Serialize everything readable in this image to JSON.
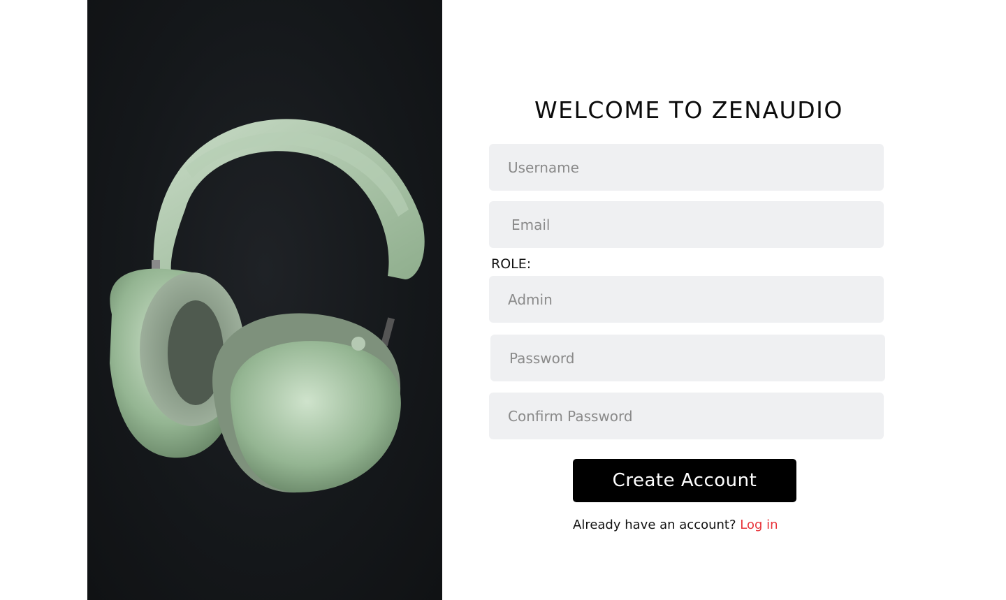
{
  "brand": {
    "welcome_title": "WELCOME TO ZENAUDIO"
  },
  "hero": {
    "image_subject": "headphones-image"
  },
  "form": {
    "username": {
      "placeholder": "Username",
      "value": ""
    },
    "email": {
      "placeholder": "Email",
      "value": ""
    },
    "role_label": "ROLE:",
    "role": {
      "placeholder": "Admin",
      "value": ""
    },
    "password": {
      "placeholder": "Password",
      "value": ""
    },
    "confirm_password": {
      "placeholder": "Confirm Password",
      "value": ""
    },
    "submit_label": "Create Account",
    "login_prompt": "Already have an account?",
    "login_link": "Log in"
  },
  "colors": {
    "field_bg": "#eff0f2",
    "button_bg": "#000000",
    "link": "#e8333a",
    "hero_bg": "#15181b",
    "headphone_green": "#a9c9a8"
  }
}
